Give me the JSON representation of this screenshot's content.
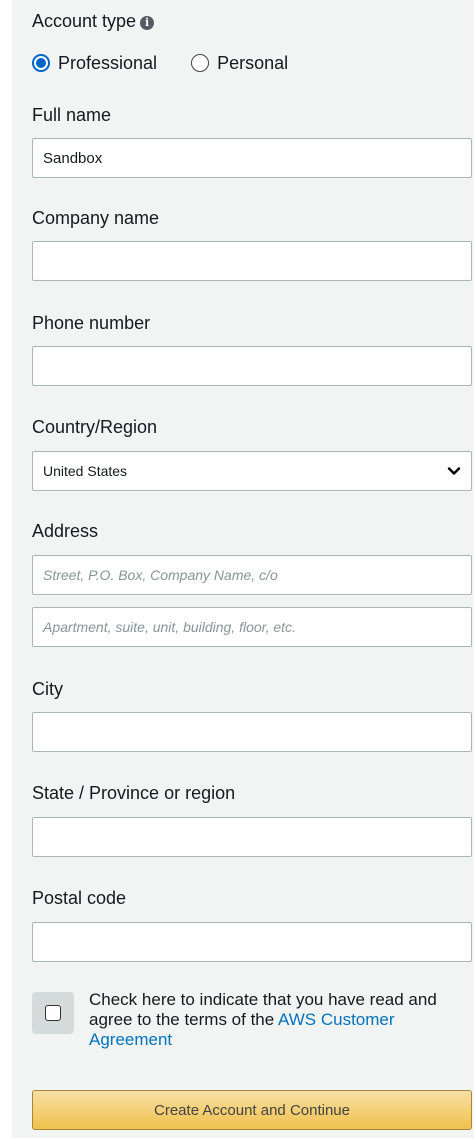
{
  "account_type": {
    "label": "Account type",
    "info_icon": "info-circle-icon",
    "options": [
      "Professional",
      "Personal"
    ],
    "selected": "Professional"
  },
  "full_name": {
    "label": "Full name",
    "value": "Sandbox"
  },
  "company_name": {
    "label": "Company name",
    "value": ""
  },
  "phone_number": {
    "label": "Phone number",
    "value": ""
  },
  "country": {
    "label": "Country/Region",
    "selected": "United States"
  },
  "address": {
    "label": "Address",
    "line1_placeholder": "Street, P.O. Box, Company Name, c/o",
    "line2_placeholder": "Apartment, suite, unit, building, floor, etc."
  },
  "city": {
    "label": "City",
    "value": ""
  },
  "state": {
    "label": "State / Province or region",
    "value": ""
  },
  "postal_code": {
    "label": "Postal code",
    "value": ""
  },
  "agreement": {
    "text": "Check here to indicate that you have read and agree to the terms of the ",
    "link_text": "AWS Customer Agreement",
    "checked": false
  },
  "submit_label": "Create Account and Continue",
  "colors": {
    "accent": "#0066cc",
    "link": "#0073bb",
    "button": "#f0c14b",
    "panel": "#f2f3f3"
  }
}
